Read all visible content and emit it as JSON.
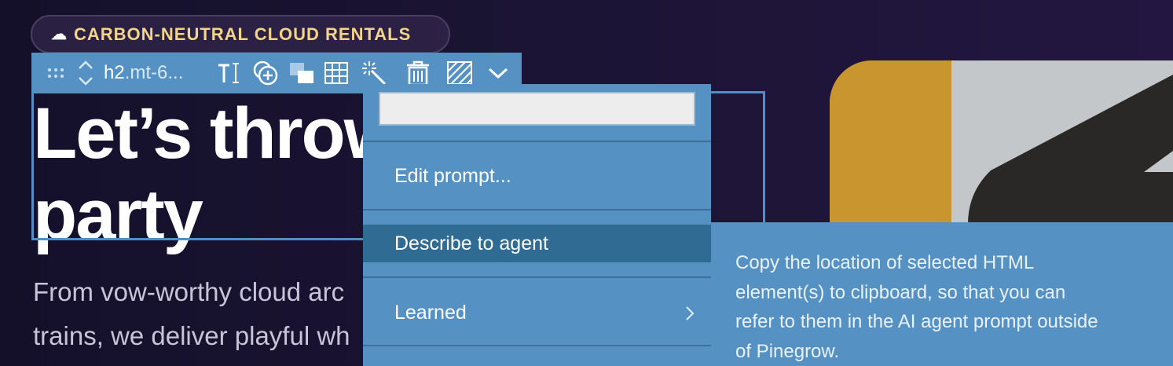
{
  "badge": {
    "icon": "cloud-icon",
    "label": "CARBON-NEUTRAL CLOUD RENTALS"
  },
  "toolbar": {
    "element_tag": "h2",
    "element_class": ".mt-6...",
    "icons": [
      "drag-handle-icon",
      "move-up-down-icon",
      "text-edit-icon",
      "add-element-icon",
      "layers-icon",
      "grid-icon",
      "ai-magic-icon",
      "delete-icon",
      "hatch-pattern-icon",
      "chevron-down-icon"
    ]
  },
  "hero": {
    "heading_line1": "Let’s throw",
    "heading_line2": "party",
    "para_line1": "From vow-worthy cloud arc",
    "para_line2": "trains, we deliver playful wh"
  },
  "menu": {
    "search_value": "",
    "items": [
      {
        "label": "Edit prompt..."
      },
      {
        "label": "Describe to agent"
      },
      {
        "label": "Learned"
      }
    ]
  },
  "tooltip": {
    "lines": [
      "Copy the location of selected HTML",
      "element(s) to clipboard, so that you can",
      "refer to them in the AI agent prompt outside",
      "of Pinegrow."
    ]
  },
  "colors": {
    "toolbar_bg": "#5591c3",
    "menu_active": "#2f6b92",
    "badge_text": "#f2d48a",
    "background": "#1b1434"
  }
}
